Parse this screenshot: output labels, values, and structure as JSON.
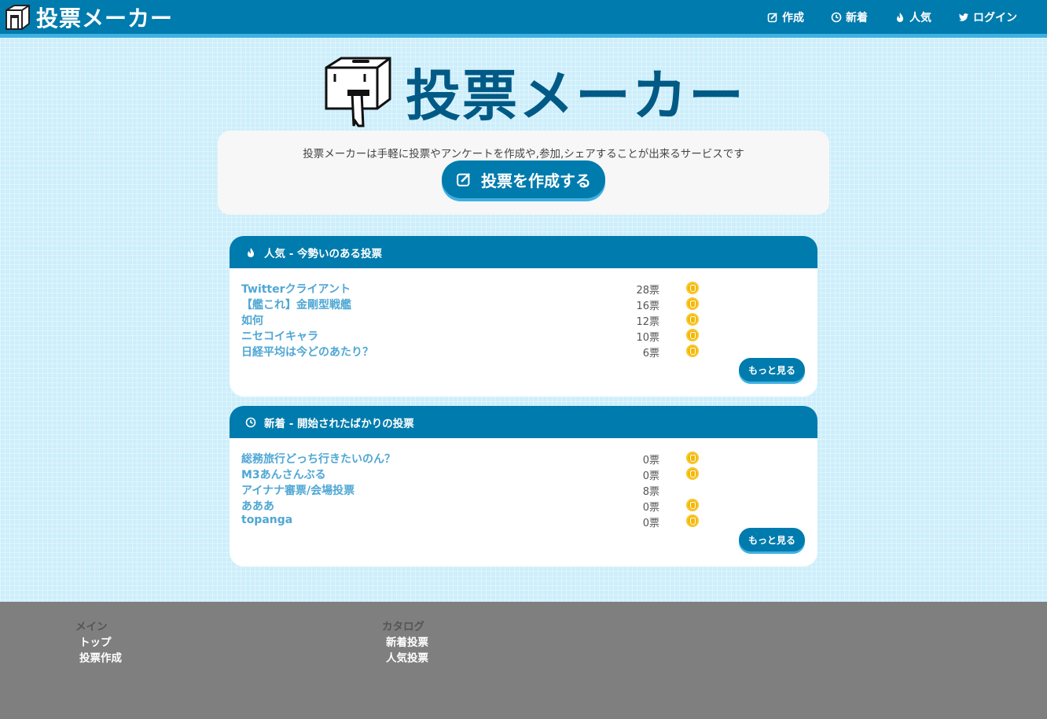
{
  "header": {
    "brand": "投票メーカー",
    "nav": [
      {
        "label": "作成",
        "icon": "edit-icon"
      },
      {
        "label": "新着",
        "icon": "clock-icon"
      },
      {
        "label": "人気",
        "icon": "fire-icon"
      },
      {
        "label": "ログイン",
        "icon": "twitter-icon"
      }
    ]
  },
  "hero": {
    "title": "投票メーカー",
    "intro": "投票メーカーは手軽に投票やアンケートを作成や,参加,シェアすることが出来るサービスです",
    "create_button": "投票を作成する"
  },
  "popular": {
    "heading": "人気 - 今勢いのある投票",
    "items": [
      {
        "title": "Twitterクライアント",
        "votes": "28票",
        "icon": true
      },
      {
        "title": "【艦これ】金剛型戦艦",
        "votes": "16票",
        "icon": true
      },
      {
        "title": "如何",
        "votes": "12票",
        "icon": true
      },
      {
        "title": "ニセコイキャラ",
        "votes": "10票",
        "icon": true
      },
      {
        "title": "日経平均は今どのあたり？",
        "votes": "6票",
        "icon": true
      }
    ],
    "more": "もっと見る"
  },
  "latest": {
    "heading": "新着 - 開始されたばかりの投票",
    "items": [
      {
        "title": "総務旅行どっち行きたいのん？",
        "votes": "0票",
        "icon": true
      },
      {
        "title": "M3あんさんぶる",
        "votes": "0票",
        "icon": true
      },
      {
        "title": "アイナナ審票/会場投票",
        "votes": "8票",
        "icon": false
      },
      {
        "title": "あああ",
        "votes": "0票",
        "icon": true
      },
      {
        "title": "topanga",
        "votes": "0票",
        "icon": true
      }
    ],
    "more": "もっと見る"
  },
  "footer": {
    "main": {
      "heading": "メイン",
      "links": [
        "トップ",
        "投票作成"
      ]
    },
    "catalog": {
      "heading": "カタログ",
      "links": [
        "新着投票",
        "人気投票"
      ]
    }
  },
  "colors": {
    "primary": "#007bad",
    "accent": "#3fb0e2",
    "link": "#4fa7d4",
    "badge": "#f5b800"
  }
}
